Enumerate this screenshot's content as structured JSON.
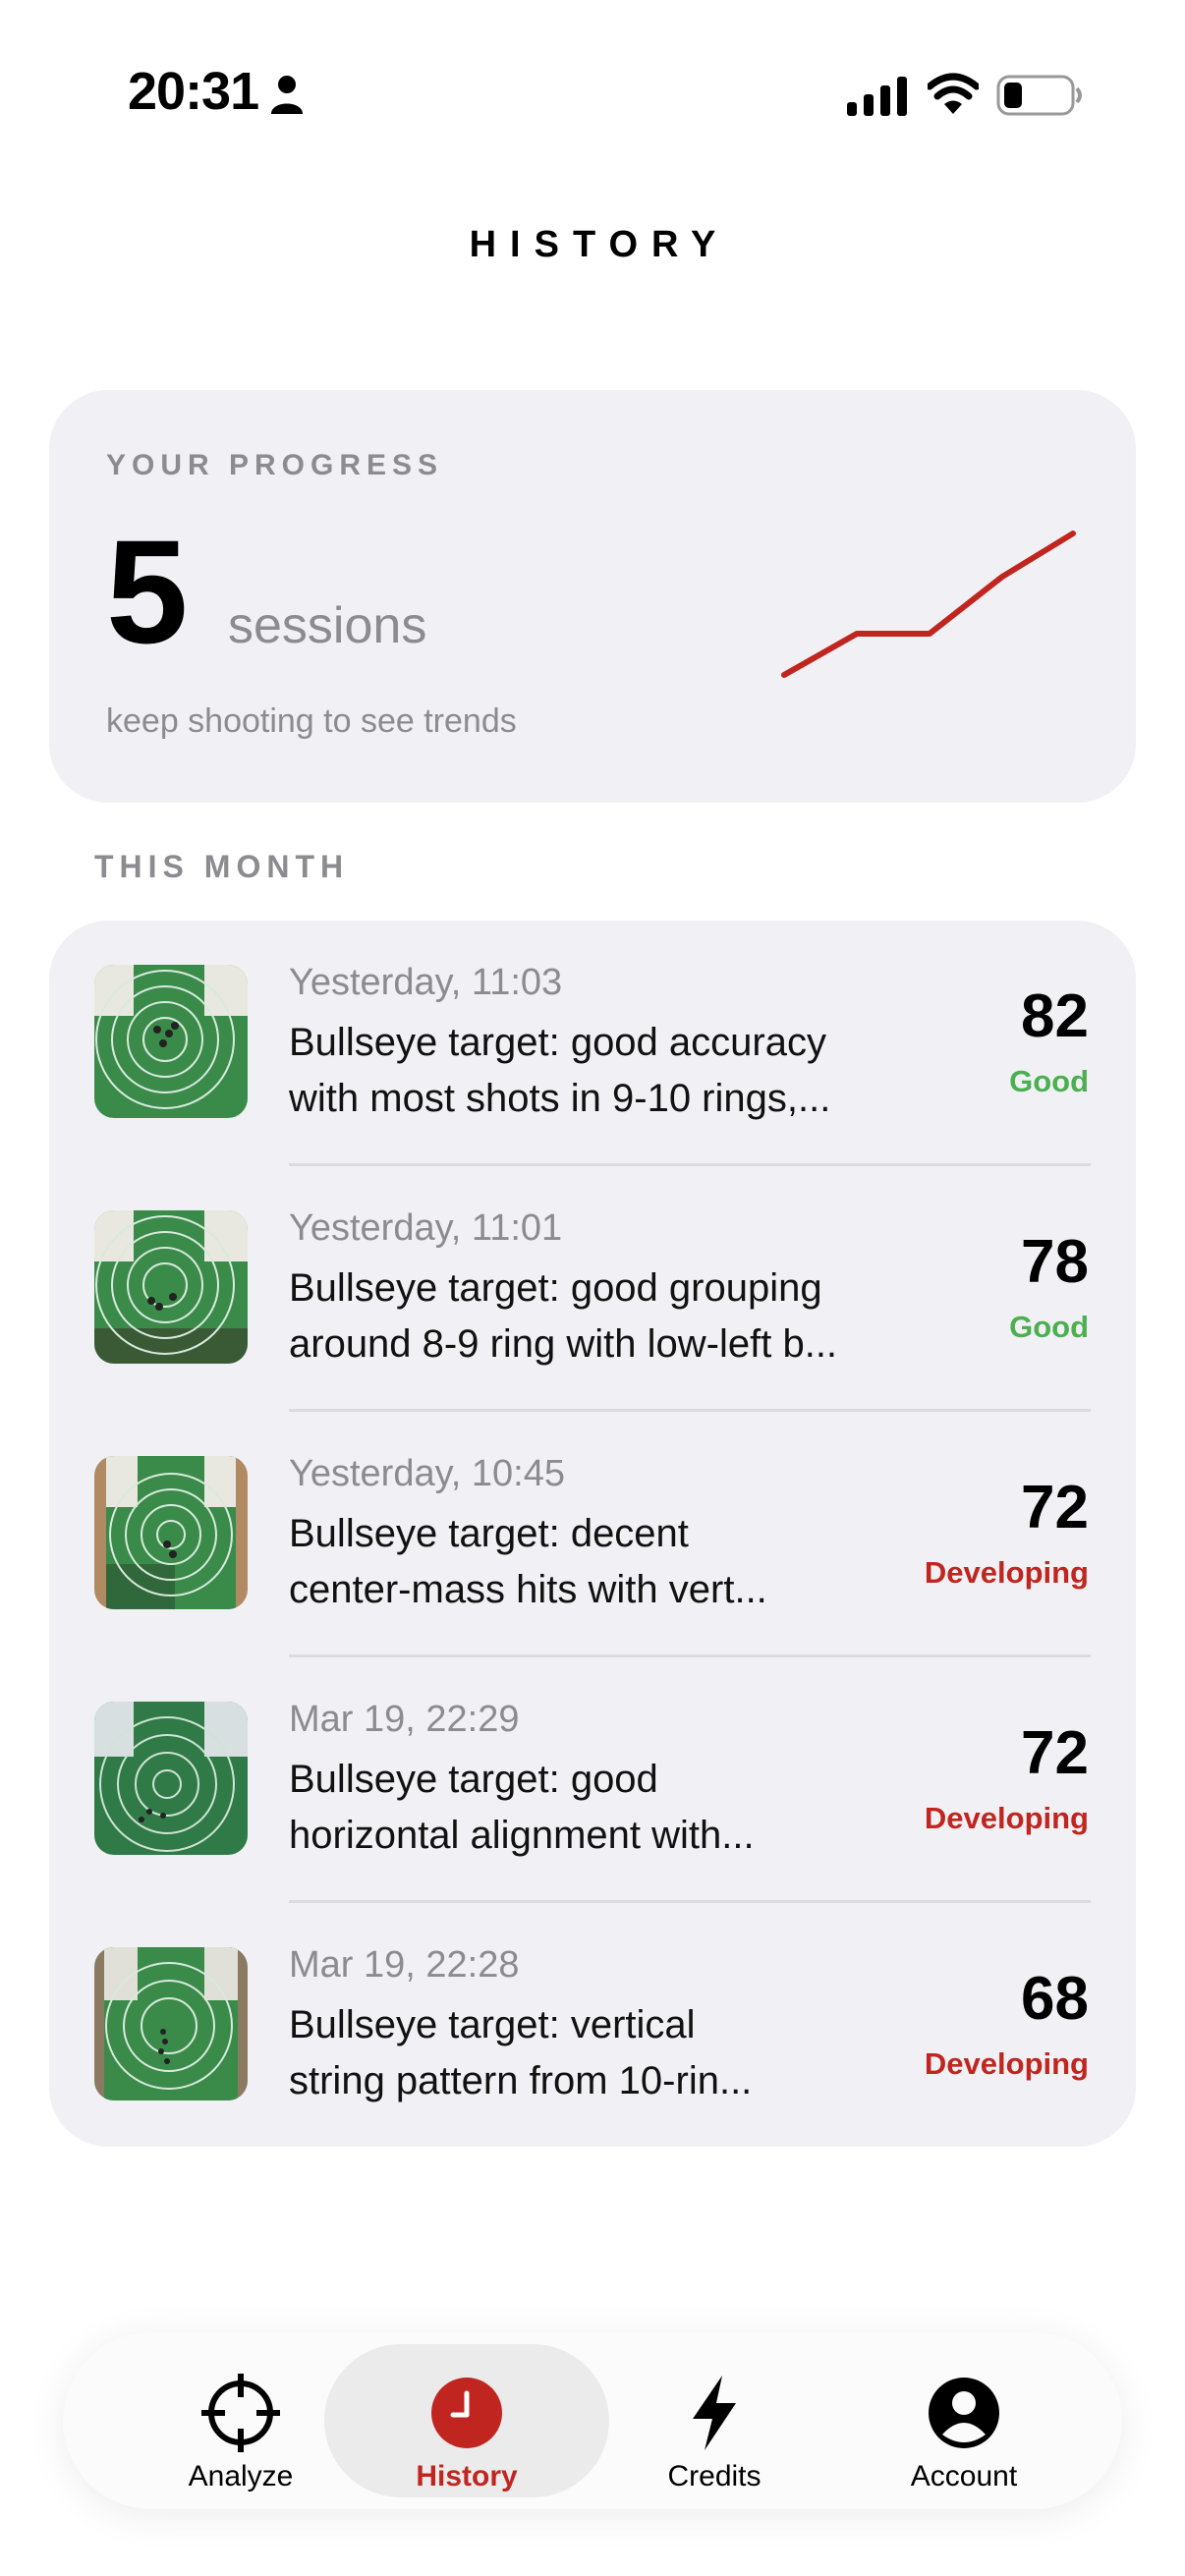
{
  "status_bar": {
    "time": "20:31"
  },
  "header": {
    "title": "HISTORY"
  },
  "progress": {
    "label": "YOUR PROGRESS",
    "count": "5",
    "unit": "sessions",
    "hint": "keep shooting to see trends",
    "trend_color": "#c0261f"
  },
  "section": {
    "label": "THIS MONTH"
  },
  "sessions": [
    {
      "date": "Yesterday, 11:03",
      "line1": "Bullseye target: good accuracy",
      "line2": "with most shots in 9-10 rings,...",
      "score": "82",
      "rating": "Good"
    },
    {
      "date": "Yesterday, 11:01",
      "line1": "Bullseye target: good grouping",
      "line2": "around 8-9 ring with low-left b...",
      "score": "78",
      "rating": "Good"
    },
    {
      "date": "Yesterday, 10:45",
      "line1": "Bullseye target: decent",
      "line2": "center-mass hits with vert...",
      "score": "72",
      "rating": "Developing"
    },
    {
      "date": "Mar 19, 22:29",
      "line1": "Bullseye target: good",
      "line2": "horizontal alignment with...",
      "score": "72",
      "rating": "Developing"
    },
    {
      "date": "Mar 19, 22:28",
      "line1": "Bullseye target: vertical",
      "line2": "string pattern from 10-rin...",
      "score": "68",
      "rating": "Developing"
    }
  ],
  "colors": {
    "good": "#4caf50",
    "developing": "#c0261f",
    "accent": "#c0261f",
    "muted": "#8b8b90"
  },
  "tabs": [
    {
      "label": "Analyze",
      "icon": "crosshair-icon"
    },
    {
      "label": "History",
      "icon": "clock-icon"
    },
    {
      "label": "Credits",
      "icon": "bolt-icon"
    },
    {
      "label": "Account",
      "icon": "person-circle-icon"
    }
  ]
}
